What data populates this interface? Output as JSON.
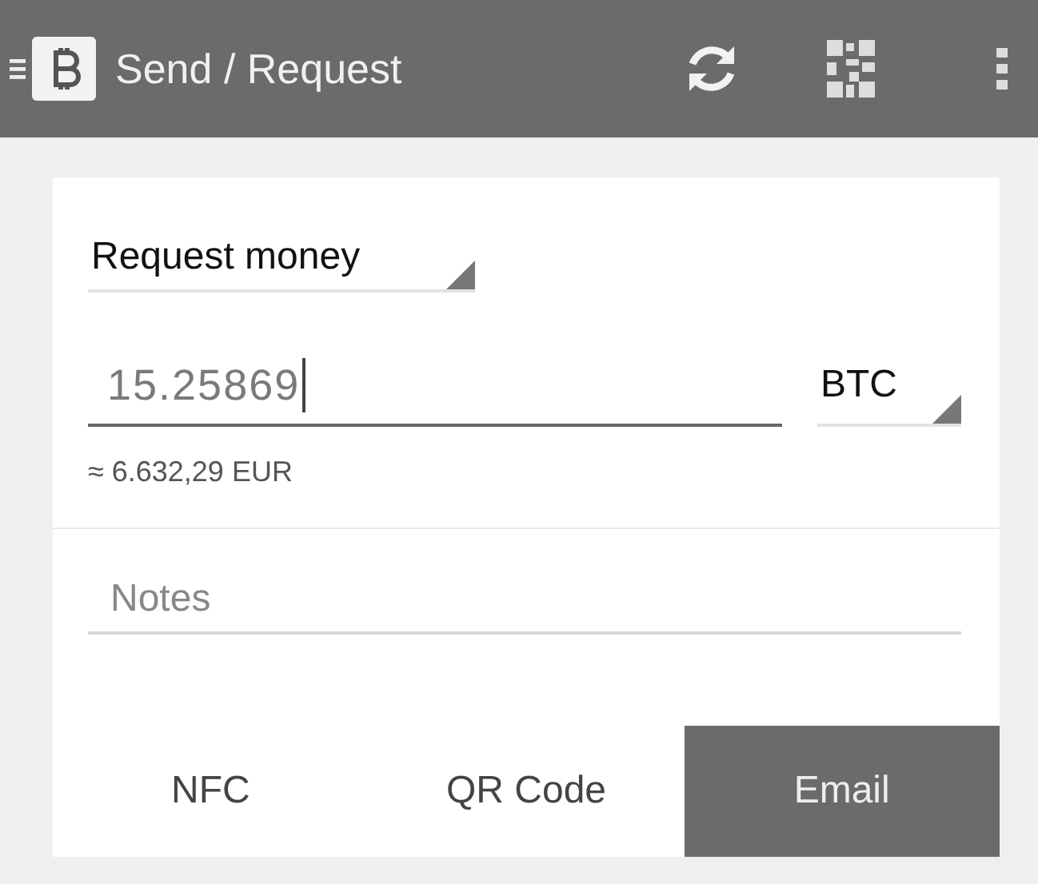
{
  "app_bar": {
    "title": "Send / Request"
  },
  "mode": {
    "value": "Request money"
  },
  "amount": {
    "value": "15.25869",
    "focused": true
  },
  "currency": {
    "value": "BTC"
  },
  "conversion": "≈ 6.632,29 EUR",
  "notes": {
    "placeholder": "Notes"
  },
  "share_options": [
    {
      "label": "NFC",
      "selected": false
    },
    {
      "label": "QR Code",
      "selected": false
    },
    {
      "label": "Email",
      "selected": true
    }
  ]
}
